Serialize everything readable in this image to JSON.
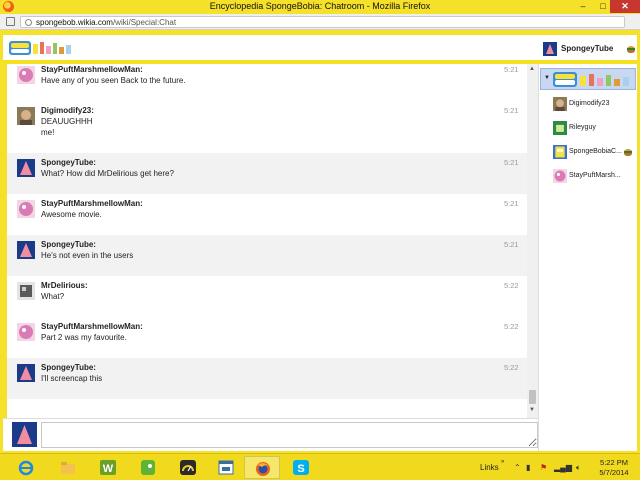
{
  "window": {
    "title": "Encyclopedia SpongeBobia: Chatroom - Mozilla Firefox",
    "minimize_glyph": "–",
    "maximize_glyph": "□",
    "close_glyph": "✕"
  },
  "address_bar": {
    "url_domain": "spongebob.wikia.com",
    "url_path": "/wiki/Special:Chat"
  },
  "header": {
    "logo_icon": "wiki-logo",
    "current_user": "SpongeyTube"
  },
  "messages": [
    {
      "user": "StayPuftMarshmellowMan:",
      "lines": [
        "Have any of you seen Back to the future."
      ],
      "time": "5:21",
      "avatar": "pink",
      "alt": false
    },
    {
      "user": "Digimodify23:",
      "lines": [
        "DEAUUGHHH",
        "me!"
      ],
      "time": "5:21",
      "avatar": "face",
      "alt": false
    },
    {
      "user": "SpongeyTube:",
      "lines": [
        "What? How did MrDelirious get here?"
      ],
      "time": "5:21",
      "avatar": "patrick",
      "alt": true
    },
    {
      "user": "StayPuftMarshmellowMan:",
      "lines": [
        "Awesome movie."
      ],
      "time": "5:21",
      "avatar": "pink",
      "alt": false
    },
    {
      "user": "SpongeyTube:",
      "lines": [
        "He's not even in the users"
      ],
      "time": "5:21",
      "avatar": "patrick",
      "alt": true
    },
    {
      "user": "MrDelirious:",
      "lines": [
        "What?"
      ],
      "time": "5:22",
      "avatar": "gray",
      "alt": false
    },
    {
      "user": "StayPuftMarshmellowMan:",
      "lines": [
        "Part 2 was my favourite."
      ],
      "time": "5:22",
      "avatar": "pink",
      "alt": false
    },
    {
      "user": "SpongeyTube:",
      "lines": [
        "I'll screencap this"
      ],
      "time": "5:22",
      "avatar": "patrick",
      "alt": true
    }
  ],
  "userlist": {
    "users": [
      {
        "name": "Digimodify23",
        "avatar": "face",
        "badge": false
      },
      {
        "name": "Rileyguy",
        "avatar": "green",
        "badge": false
      },
      {
        "name": "SpongeBobiaC...",
        "avatar": "sponge",
        "badge": true
      },
      {
        "name": "StayPuftMarsh...",
        "avatar": "pink",
        "badge": false
      }
    ]
  },
  "input": {
    "placeholder": ""
  },
  "taskbar": {
    "apps": [
      "ie-icon",
      "file-explorer-icon",
      "wordweb-icon",
      "evernote-icon",
      "speedometer-icon",
      "window-icon",
      "firefox-icon",
      "skype-icon"
    ],
    "links_label": "Links",
    "chevron": "»",
    "time": "5:22 PM",
    "date": "5/7/2014"
  },
  "colors": {
    "accent_yellow": "#f5e12a",
    "alt_row": "#f2f2f2"
  }
}
